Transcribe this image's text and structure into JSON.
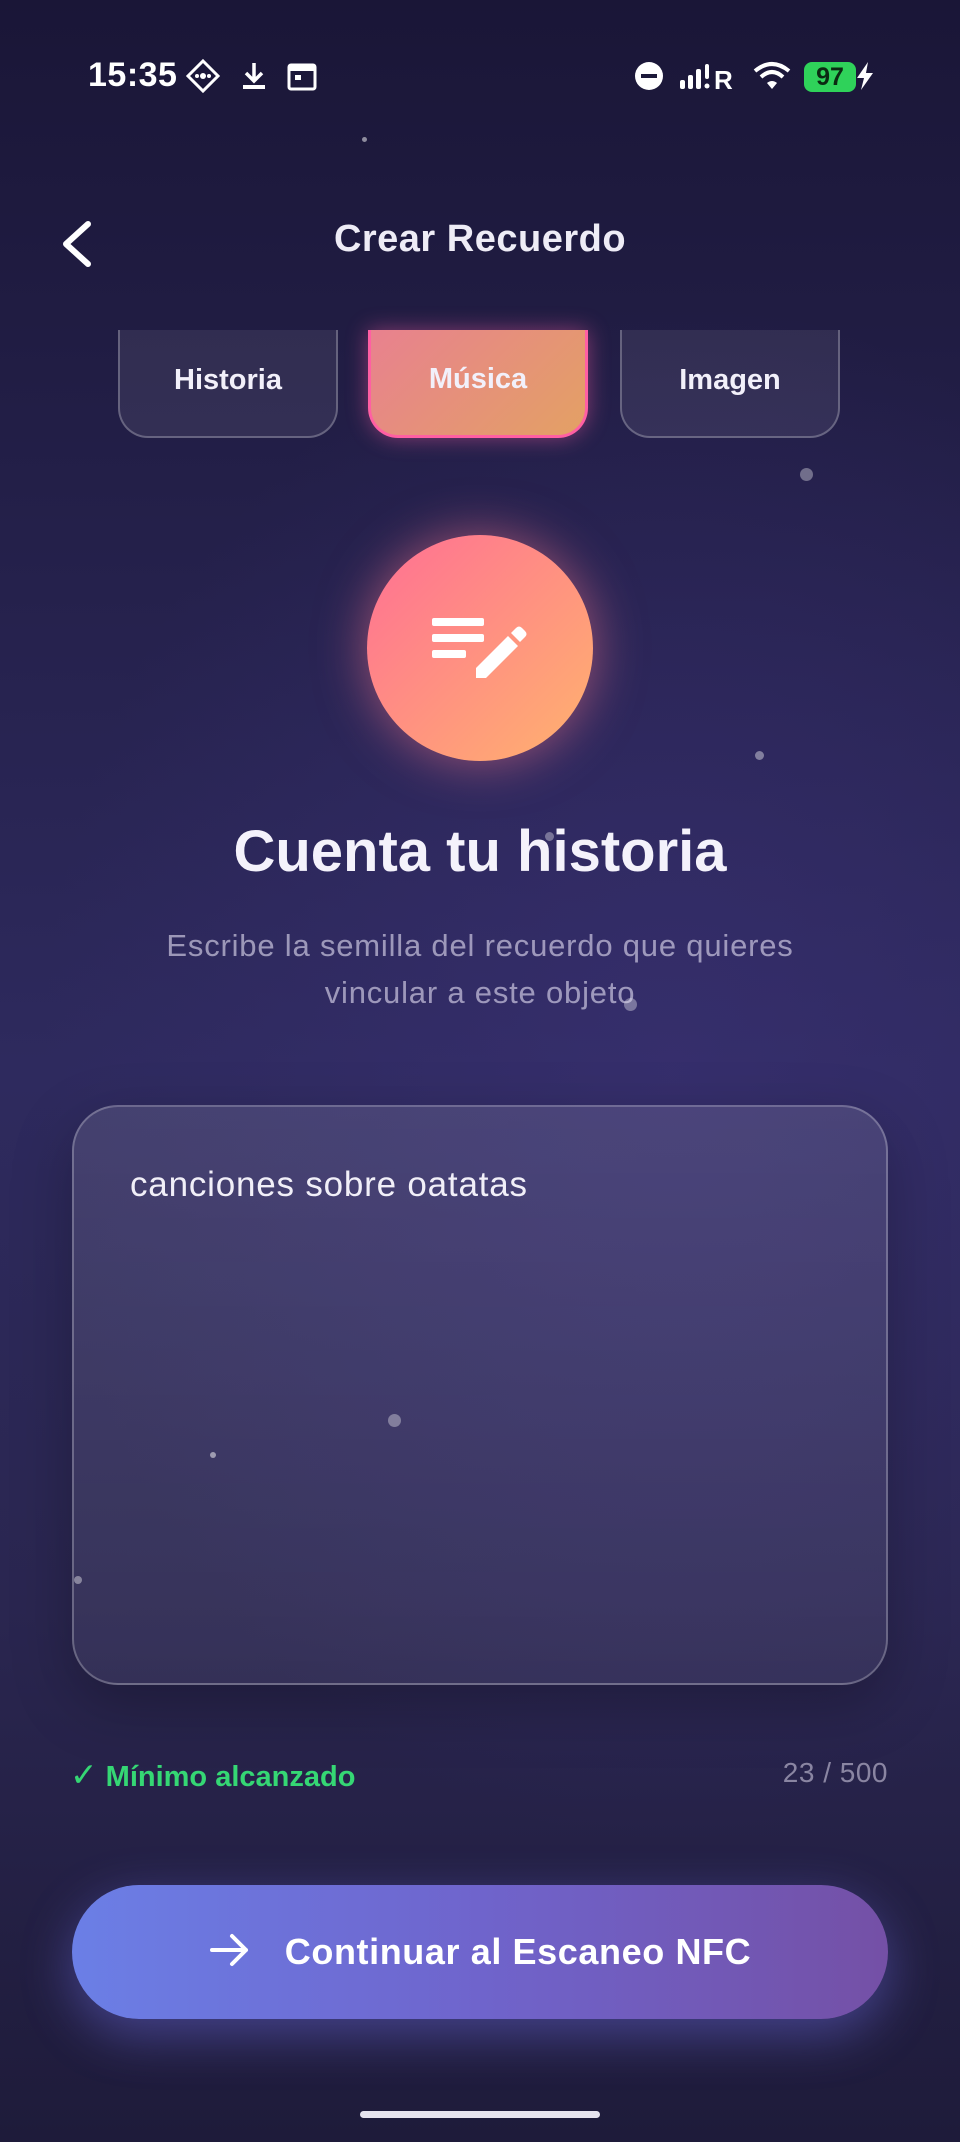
{
  "status_bar": {
    "time": "15:35",
    "battery": "97",
    "icons": [
      "location-pin-icon",
      "download-icon",
      "calendar-icon",
      "do-not-disturb-icon",
      "signal-icon",
      "wifi-icon",
      "charging-bolt-icon"
    ]
  },
  "header": {
    "title": "Crear Recuerdo",
    "back_icon": "chevron-left-icon"
  },
  "tabs": [
    {
      "label": "Historia",
      "active": false
    },
    {
      "label": "Música",
      "active": true
    },
    {
      "label": "Imagen",
      "active": false
    }
  ],
  "hero": {
    "icon": "edit-note-icon",
    "heading": "Cuenta tu historia",
    "subheading": "Escribe la semilla del recuerdo que quieres vincular a este objeto"
  },
  "story_input": {
    "value": "canciones sobre oatatas"
  },
  "validation": {
    "status": "Mínimo alcanzado",
    "count": "23 / 500"
  },
  "continue_button": {
    "label": "Continuar al Escaneo NFC",
    "icon": "arrow-right-icon"
  },
  "colors": {
    "accent_gradient_start": "#6b7fe6",
    "accent_gradient_end": "#7450a6",
    "active_tab_border": "#ff5fa3",
    "success": "#35d774"
  }
}
